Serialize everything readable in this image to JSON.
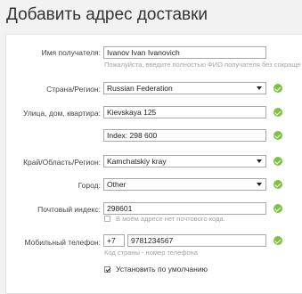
{
  "page": {
    "title": "Добавить адрес доставки"
  },
  "form": {
    "recipient": {
      "label": "Имя получателя:",
      "value": "Ivanov Ivan Ivanovich",
      "hint": "Пожалуйста, введите полностью ФИО получателя без сокраще"
    },
    "country": {
      "label": "Страна/Регион:",
      "value": "Russian Federation"
    },
    "street": {
      "label": "Улица, дом, квартира:",
      "value": "Kievskaya 125"
    },
    "street2": {
      "value": "Index: 298 600"
    },
    "region": {
      "label": "Край/Область/Регион:",
      "value": "Kamchatskiy kray"
    },
    "city": {
      "label": "Город:",
      "value": "Other"
    },
    "postal": {
      "label": "Почтовый индекс:",
      "value": "298601",
      "no_postal_label": "В моём адресе нет почтового кода."
    },
    "phone": {
      "label": "Мобильный телефон:",
      "country_code": "+7",
      "number": "9781234567",
      "hint": "Код страны - номер телефона"
    },
    "default": {
      "label": "Установить по умолчанию",
      "checked": true
    }
  },
  "colors": {
    "valid": "#7dc142",
    "background": "#f2f2f2",
    "panel": "#ffffff"
  }
}
